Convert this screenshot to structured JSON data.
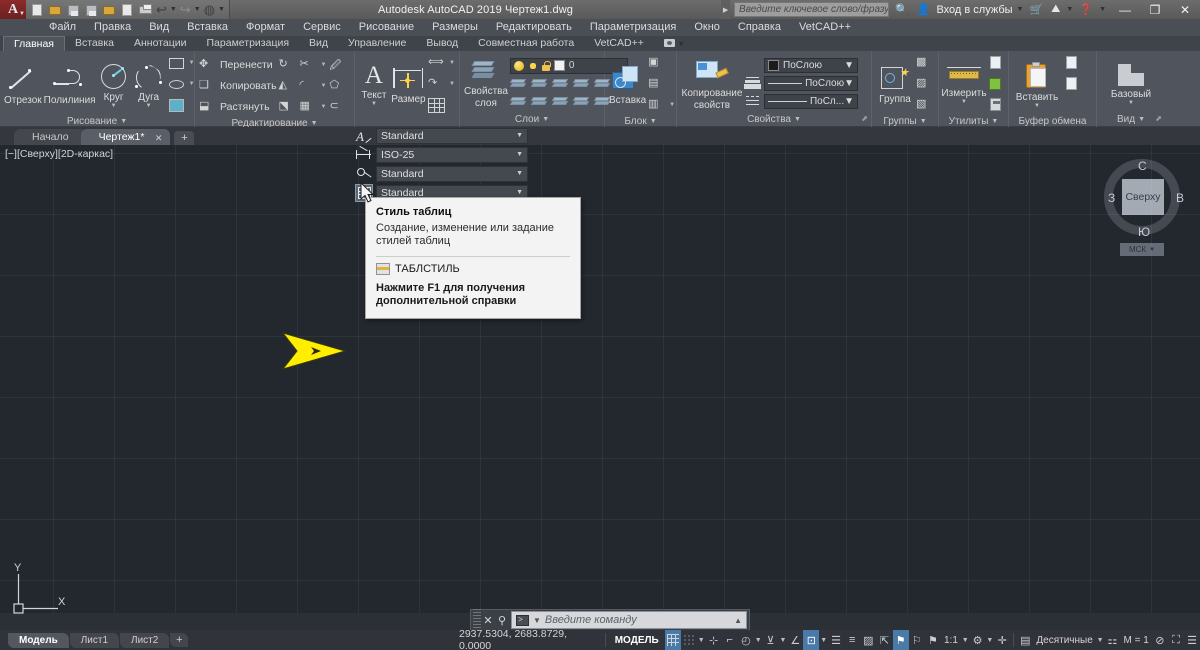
{
  "titlebar": {
    "app_title": "Autodesk AutoCAD 2019   Чертеж1.dwg",
    "logo_glyph": "A",
    "search_placeholder": "Введите ключевое слово/фразу",
    "signin_label": "Вход в службы",
    "qat": [
      {
        "name": "new-file",
        "label": "Создать"
      },
      {
        "name": "open-file",
        "label": "Открыть"
      },
      {
        "name": "save-file",
        "label": "Сохранить"
      },
      {
        "name": "save-as",
        "label": "Сохранить как"
      },
      {
        "name": "plot-preview",
        "label": "Предварительный просмотр"
      },
      {
        "name": "web-save",
        "label": "Сохранить в Интернете"
      },
      {
        "name": "print",
        "label": "Печать"
      }
    ],
    "window_buttons": {
      "minimize": "—",
      "maximize": "❐",
      "close": "✕"
    }
  },
  "menubar": {
    "items": [
      "Файл",
      "Правка",
      "Вид",
      "Вставка",
      "Формат",
      "Сервис",
      "Рисование",
      "Размеры",
      "Редактировать",
      "Параметризация",
      "Окно",
      "Справка",
      "VetCAD++"
    ]
  },
  "ribbon_tabs": {
    "items": [
      "Главная",
      "Вставка",
      "Аннотации",
      "Параметризация",
      "Вид",
      "Управление",
      "Вывод",
      "Совместная работа",
      "VetCAD++"
    ],
    "active": "Главная"
  },
  "ribbon": {
    "draw": {
      "label": "Рисование",
      "buttons": [
        {
          "name": "line-tool",
          "label": "Отрезок"
        },
        {
          "name": "polyline-tool",
          "label": "Полилиния"
        },
        {
          "name": "circle-tool",
          "label": "Круг"
        },
        {
          "name": "arc-tool",
          "label": "Дуга"
        }
      ]
    },
    "modify": {
      "label": "Редактирование",
      "buttons": [
        {
          "name": "move-tool",
          "label": "Перенести"
        },
        {
          "name": "copy-tool",
          "label": "Копировать"
        },
        {
          "name": "stretch-tool",
          "label": "Растянуть"
        }
      ]
    },
    "annotation": {
      "label": "",
      "buttons": [
        {
          "name": "text-tool",
          "label": "Текст"
        },
        {
          "name": "dimension-tool",
          "label": "Размер"
        }
      ]
    },
    "layers": {
      "label": "Слои",
      "button": "Свойства слоя",
      "button_line1": "Свойства",
      "button_line2": "слоя",
      "current_layer": "0"
    },
    "block": {
      "label": "Блок",
      "button": "Вставка"
    },
    "properties": {
      "label": "Свойства",
      "match_button_line1": "Копирование",
      "match_button_line2": "свойств",
      "color": "ПоСлою",
      "lineweight": "ПоСлою",
      "linetype": "ПоСл..."
    },
    "groups": {
      "label": "Группы",
      "button": "Группа"
    },
    "utilities": {
      "label": "Утилиты",
      "button": "Измерить"
    },
    "clipboard": {
      "label": "Буфер обмена",
      "button": "Вставить"
    },
    "view": {
      "label": "Вид",
      "button": "Базовый"
    }
  },
  "drawing_tabs": {
    "items": [
      {
        "name": "start-tab",
        "label": "Начало",
        "active": false
      },
      {
        "name": "drawing1-tab",
        "label": "Чертеж1*",
        "active": true
      }
    ],
    "close_glyph": "✕",
    "new_glyph": "+"
  },
  "canvas": {
    "viewport_label": "[−][Сверху][2D-каркас]",
    "ucs_x": "X",
    "ucs_y": "Y",
    "background_color": "#23272e",
    "annotation_arrow_color": "#ffee00"
  },
  "viewcube": {
    "face": "Сверху",
    "north": "С",
    "west": "З",
    "east": "В",
    "south": "Ю",
    "ucs_label": "МСК"
  },
  "style_dropdowns": {
    "rows": [
      {
        "name": "text-style-dropdown",
        "icon": "text-style-icon",
        "value": "Standard"
      },
      {
        "name": "dimension-style-dropdown",
        "icon": "dimension-style-icon",
        "value": "ISO-25"
      },
      {
        "name": "multileader-style-dropdown",
        "icon": "multileader-style-icon",
        "value": "Standard"
      },
      {
        "name": "table-style-dropdown",
        "icon": "table-style-icon",
        "value": "Standard"
      }
    ],
    "caret": "▼"
  },
  "tooltip": {
    "title": "Стиль таблиц",
    "description": "Создание, изменение или задание стилей таблиц",
    "command": "ТАБЛСТИЛЬ",
    "help_line1": "Нажмите F1 для получения",
    "help_line2": "дополнительной справки"
  },
  "command_line": {
    "placeholder": "Введите команду",
    "close_glyph": "✕",
    "expand_glyph": "▲"
  },
  "layout_tabs": {
    "items": [
      {
        "name": "model-tab",
        "label": "Модель",
        "active": true
      },
      {
        "name": "layout1-tab",
        "label": "Лист1",
        "active": false
      },
      {
        "name": "layout2-tab",
        "label": "Лист2",
        "active": false
      }
    ],
    "new_glyph": "+"
  },
  "status_bar": {
    "coordinates": "2937.5304, 2683.8729, 0.0000",
    "model_label": "МОДЕЛЬ",
    "scale": "1:1",
    "units": "Десятичные",
    "annotation_scale": "M = 1",
    "toggles": [
      {
        "name": "grid-toggle",
        "label": "Сетка",
        "active": true
      },
      {
        "name": "snap-toggle",
        "label": "Шаговая привязка",
        "active": false
      },
      {
        "name": "infer-constraints",
        "label": "Зависимости",
        "active": false
      },
      {
        "name": "ortho-toggle",
        "label": "Орто",
        "active": false
      },
      {
        "name": "polar-toggle",
        "label": "Полярное отслеживание",
        "active": false
      },
      {
        "name": "osnap-toggle",
        "label": "Объектная привязка",
        "active": false
      },
      {
        "name": "otrack-toggle",
        "label": "Объектное отслеживание",
        "active": false
      },
      {
        "name": "dyn-ucs-toggle",
        "label": "Динамическая ПСК",
        "active": true
      },
      {
        "name": "dynamic-input",
        "label": "Динамический ввод",
        "active": false
      },
      {
        "name": "lineweight-toggle",
        "label": "Вес линий",
        "active": false
      },
      {
        "name": "transparency-toggle",
        "label": "Прозрачность",
        "active": false
      },
      {
        "name": "selection-cycling",
        "label": "Цикл выбора",
        "active": true
      },
      {
        "name": "annotation-visibility",
        "label": "Видимость аннотаций",
        "active": false
      },
      {
        "name": "autoscale-toggle",
        "label": "Автомасштаб",
        "active": false
      }
    ]
  }
}
